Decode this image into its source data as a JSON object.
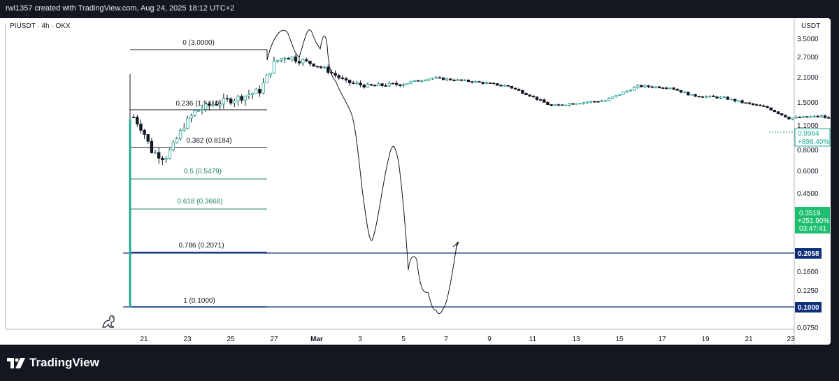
{
  "header": {
    "caption": "rwl1357 created with TradingView.com, Aug 24, 2025 18:12 UTC+2"
  },
  "legend": {
    "symbol": "PIUSDT · 4h · OKX"
  },
  "price_axis": {
    "currency": "USDT",
    "ticks": [
      "3.5000",
      "2.7000",
      "2.1000",
      "1.5000",
      "1.1000",
      "0.8000",
      "0.6000",
      "0.4500",
      "0.1600",
      "0.1250",
      "0.0750"
    ]
  },
  "time_axis": {
    "ticks": [
      "21",
      "23",
      "25",
      "27",
      "Mar",
      "3",
      "5",
      "7",
      "9",
      "11",
      "13",
      "15",
      "17",
      "19",
      "21",
      "23"
    ]
  },
  "fib_levels": [
    {
      "label": "0 (3.0000)",
      "color": "#131722"
    },
    {
      "label": "0.236 (1.5410)",
      "color": "#131722"
    },
    {
      "label": "0.382 (0.8184)",
      "color": "#131722"
    },
    {
      "label": "0.5 (0.5479)",
      "color": "#22866b"
    },
    {
      "label": "0.618 (0.3668)",
      "color": "#22866b"
    },
    {
      "label": "0.786 (0.2071)",
      "color": "#0d2f7c"
    },
    {
      "label": "1 (0.1000)",
      "color": "#0d2f7c"
    }
  ],
  "badges": {
    "last_price": "0.9984",
    "last_change": "+898.40%",
    "green_price": "0.3519",
    "green_change": "+251.90%",
    "countdown": "03:47:41",
    "level_1": "0.2058",
    "level_2": "0.1000"
  },
  "brand": {
    "name": "TradingView"
  },
  "colors": {
    "up": "#22ab94",
    "down": "#131722",
    "horizontal_line": "#0d2f7c",
    "badge_green": "#1fbf72"
  },
  "chart_data": {
    "type": "candlestick",
    "title": "PIUSDT · 4h · OKX",
    "scale": "log",
    "ylim": [
      0.0725,
      4.0
    ],
    "x_ticks": [
      "21",
      "23",
      "25",
      "27",
      "Mar",
      "3",
      "5",
      "7",
      "9",
      "11",
      "13",
      "15",
      "17",
      "19",
      "21",
      "23"
    ],
    "price_path": [
      [
        20.0,
        0.1,
        1.25
      ],
      [
        20.6,
        0.98
      ],
      [
        21.0,
        0.75
      ],
      [
        21.6,
        0.68
      ],
      [
        22.0,
        0.8
      ],
      [
        22.5,
        1.05
      ],
      [
        23.0,
        1.25
      ],
      [
        23.8,
        1.38
      ],
      [
        25.0,
        1.5
      ],
      [
        26.0,
        1.65
      ],
      [
        26.7,
        2.4
      ],
      [
        27.2,
        2.6
      ],
      [
        28.0,
        2.45
      ],
      [
        29.0,
        2.2
      ],
      [
        30.0,
        1.85
      ],
      [
        31.0,
        1.75
      ],
      [
        32.5,
        1.8
      ],
      [
        34.0,
        1.95
      ],
      [
        36.0,
        1.85
      ],
      [
        37.5,
        1.75
      ],
      [
        38.5,
        1.55
      ],
      [
        39.5,
        1.35
      ],
      [
        40.5,
        1.4
      ],
      [
        42.0,
        1.45
      ],
      [
        43.5,
        1.75
      ],
      [
        45.0,
        1.72
      ],
      [
        46.0,
        1.55
      ],
      [
        47.5,
        1.5
      ],
      [
        48.5,
        1.4
      ],
      [
        49.5,
        1.32
      ],
      [
        50.5,
        1.15
      ],
      [
        52.0,
        1.18
      ],
      [
        52.8,
        1.1
      ],
      [
        53.3,
        0.88
      ],
      [
        53.7,
        1.05
      ],
      [
        55.0,
        0.98
      ]
    ],
    "fibonacci": {
      "levels": [
        0,
        0.236,
        0.382,
        0.5,
        0.618,
        0.786,
        1
      ],
      "prices": [
        3.0,
        1.541,
        0.8184,
        0.5479,
        0.3668,
        0.2071,
        0.1
      ]
    },
    "horizontal_lines": [
      0.2058,
      0.1
    ],
    "last_price": 0.9984
  }
}
